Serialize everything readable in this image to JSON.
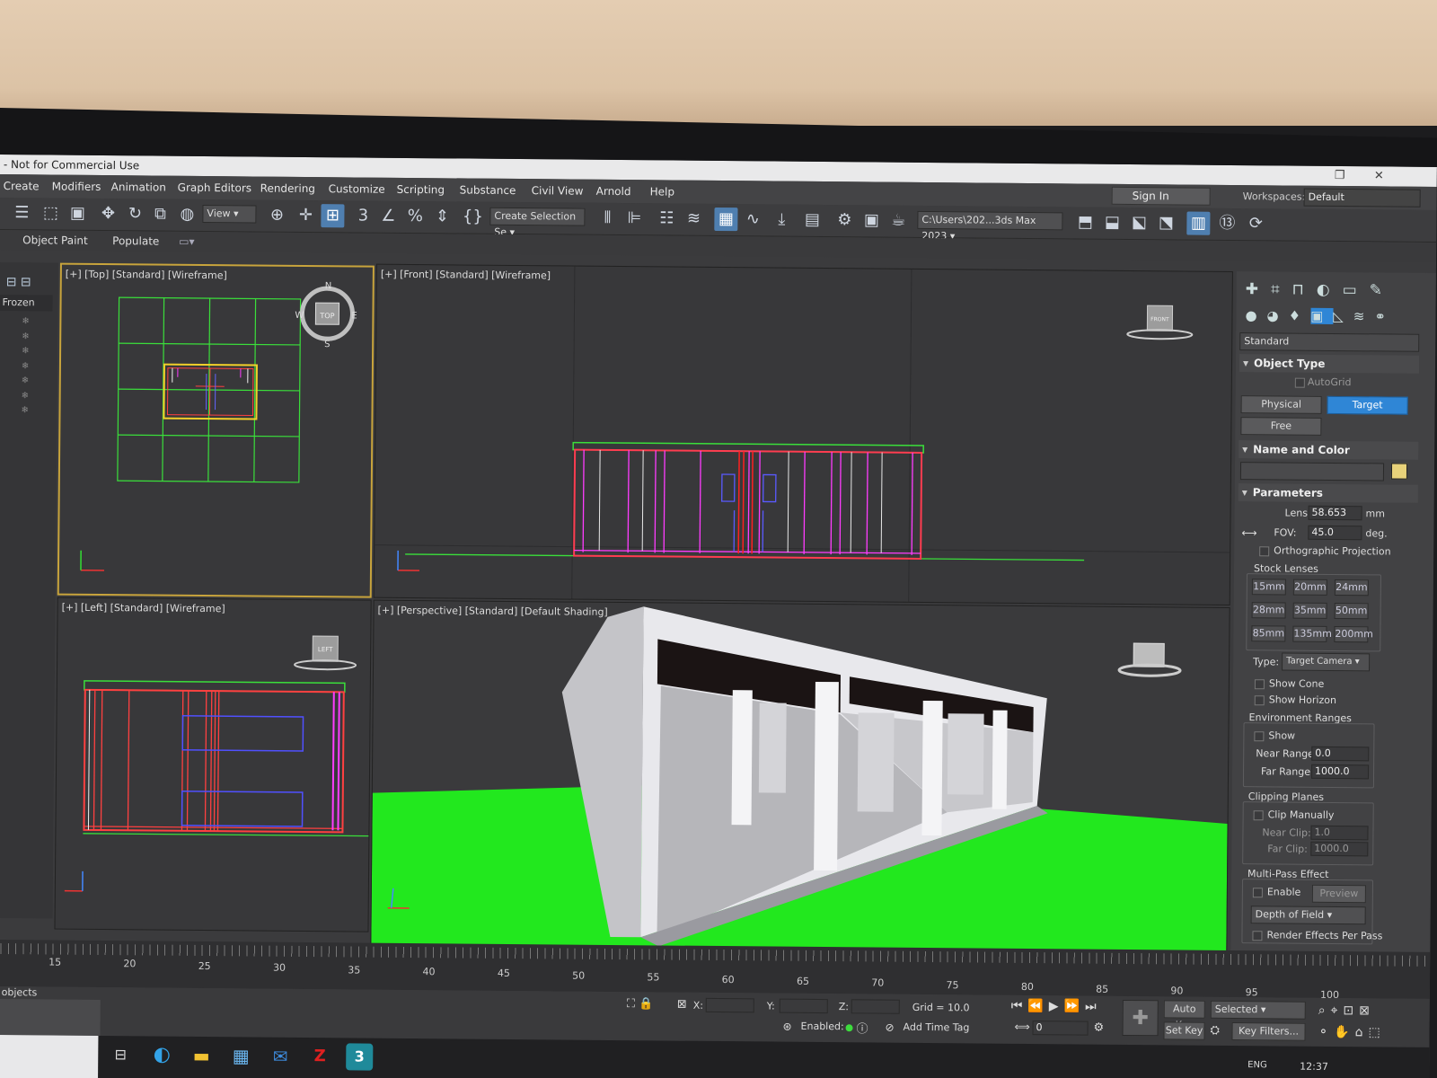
{
  "window": {
    "title": "- Not for Commercial Use"
  },
  "menu": [
    "Create",
    "Modifiers",
    "Animation",
    "Graph Editors",
    "Rendering",
    "Customize",
    "Scripting",
    "Substance",
    "Civil View",
    "Arnold",
    "Help"
  ],
  "signin": "Sign In",
  "workspaces": {
    "label": "Workspaces:",
    "value": "Default"
  },
  "toolbar": {
    "view_drop": "View",
    "selection_set": "Create Selection Se",
    "path": "C:\\Users\\202...3ds Max 2023",
    "snap_label": "3"
  },
  "ribbon": {
    "object_paint": "Object Paint",
    "populate": "Populate"
  },
  "scene": {
    "frozen": "Frozen"
  },
  "viewports": {
    "top": "[+] [Top] [Standard] [Wireframe]",
    "front": "[+] [Front] [Standard] [Wireframe]",
    "left": "[+] [Left] [Standard] [Wireframe]",
    "perspective": "[+] [Perspective] [Standard] [Default Shading]",
    "compass": {
      "n": "N",
      "s": "S",
      "e": "E",
      "w": "W",
      "cube": "TOP"
    },
    "front_cube": "FRONT",
    "left_cube": "LEFT"
  },
  "command_panel": {
    "category": "Standard",
    "object_type": {
      "title": "Object Type",
      "autogrid": "AutoGrid",
      "physical": "Physical",
      "target": "Target",
      "free": "Free"
    },
    "name_color": {
      "title": "Name and Color",
      "swatch": "#e8d27a"
    },
    "parameters": {
      "title": "Parameters",
      "lens_label": "Lens:",
      "lens_value": "58.653",
      "lens_unit": "mm",
      "fov_label": "FOV:",
      "fov_value": "45.0",
      "fov_unit": "deg.",
      "ortho": "Orthographic Projection",
      "stock_lenses": "Stock Lenses",
      "lenses": [
        "15mm",
        "20mm",
        "24mm",
        "28mm",
        "35mm",
        "50mm",
        "85mm",
        "135mm",
        "200mm"
      ],
      "type_label": "Type:",
      "type_value": "Target Camera",
      "show_cone": "Show Cone",
      "show_horizon": "Show Horizon",
      "env_ranges": "Environment Ranges",
      "env_show": "Show",
      "near_range_label": "Near Range:",
      "near_range": "0.0",
      "far_range_label": "Far Range:",
      "far_range": "1000.0",
      "clipping": "Clipping Planes",
      "clip_manually": "Clip Manually",
      "near_clip_label": "Near Clip:",
      "near_clip": "1.0",
      "far_clip_label": "Far Clip:",
      "far_clip": "1000.0",
      "multipass": "Multi-Pass Effect",
      "enable": "Enable",
      "preview": "Preview",
      "effect": "Depth of Field",
      "render_effects": "Render Effects Per Pass"
    }
  },
  "timeline": {
    "ticks": [
      "15",
      "20",
      "25",
      "30",
      "35",
      "40",
      "45",
      "50",
      "55",
      "60",
      "65",
      "70",
      "75",
      "80",
      "85",
      "90",
      "95",
      "100"
    ]
  },
  "status": {
    "objects": "t objects",
    "x": "X:",
    "y": "Y:",
    "z": "Z:",
    "grid": "Grid = 10.0",
    "enabled": "Enabled:",
    "add_time_tag": "Add Time Tag",
    "autokey": "Auto Key",
    "selected": "Selected",
    "setkey": "Set Key",
    "keyfilters": "Key Filters...",
    "frame": "0"
  },
  "taskbar": {
    "lang": "ENG",
    "time": "12:37"
  },
  "colors": {
    "accent": "#2f86d6",
    "active_border": "#c8a43c",
    "ground": "#22e81e"
  }
}
